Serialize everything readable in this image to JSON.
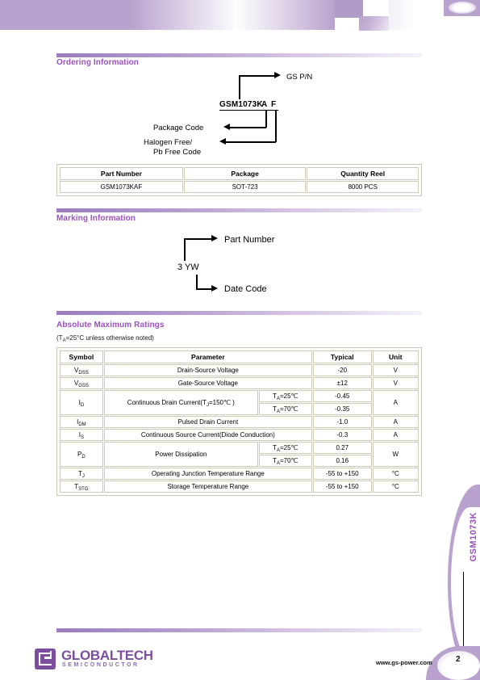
{
  "document": {
    "part": "GSM1073K",
    "page_number": "2",
    "website": "www.gs-power.com",
    "company": "GLOBALTECH",
    "company_sub": "SEMICONDUCTOR",
    "brand_color": "#9b51c0",
    "logo_color": "#7b4f9e",
    "banner_color": "#b9a2cd"
  },
  "ordering": {
    "title": "Ordering Information",
    "diagram": {
      "part_number_base": "GSM1073K",
      "code_a": "A",
      "code_f": "F",
      "label_gs_pn": "GS P/N",
      "label_package_code": "Package Code",
      "label_halogen_1": "Halogen Free/",
      "label_halogen_2": "Pb Free Code"
    },
    "table": {
      "headers": [
        "Part Number",
        "Package",
        "Quantity Reel"
      ],
      "rows": [
        [
          "GSM1073KAF",
          "SOT-723",
          "8000 PCS"
        ]
      ]
    }
  },
  "marking": {
    "title": "Marking Information",
    "code": "3 YW",
    "label_part_number": "Part Number",
    "label_date_code": "Date Code"
  },
  "ratings": {
    "title": "Absolute Maximum Ratings",
    "subtitle_pre": "(T",
    "subtitle_sub": "A",
    "subtitle_post": "=25°C unless otherwise noted)",
    "headers": [
      "Symbol",
      "Parameter",
      "Typical",
      "Unit"
    ],
    "rows": [
      {
        "symbol": "V",
        "symbol_sub": "DSS",
        "parameter": "Drain-Source Voltage",
        "condition": "",
        "typical": "-20",
        "unit": "V"
      },
      {
        "symbol": "V",
        "symbol_sub": "GSS",
        "parameter": "Gate-Source Voltage",
        "condition": "",
        "typical": "±12",
        "unit": "V"
      },
      {
        "symbol": "I",
        "symbol_sub": "D",
        "parameter": "Continuous Drain Current(T",
        "parameter_sub": "J",
        "parameter_post": "=150℃ )",
        "conditions": [
          "Tᴀ=25℃",
          "Tᴀ=70℃"
        ],
        "condition_1_pre": "T",
        "condition_1_sub": "A",
        "condition_1_post": "=25℃",
        "condition_2_pre": "T",
        "condition_2_sub": "A",
        "condition_2_post": "=70℃",
        "typicals": [
          "-0.45",
          "-0.35"
        ],
        "unit": "A"
      },
      {
        "symbol": "I",
        "symbol_sub": "DM",
        "parameter": "Pulsed Drain Current",
        "condition": "",
        "typical": "-1.0",
        "unit": "A"
      },
      {
        "symbol": "I",
        "symbol_sub": "S",
        "parameter": "Continuous Source Current(Diode Conduction)",
        "condition": "",
        "typical": "-0.3",
        "unit": "A"
      },
      {
        "symbol": "P",
        "symbol_sub": "D",
        "parameter": "Power Dissipation",
        "condition_1_pre": "T",
        "condition_1_sub": "A",
        "condition_1_post": "=25℃",
        "condition_2_pre": "T",
        "condition_2_sub": "A",
        "condition_2_post": "=70℃",
        "typicals": [
          "0.27",
          "0.16"
        ],
        "unit": "W"
      },
      {
        "symbol": "T",
        "symbol_sub": "J",
        "parameter": "Operating Junction Temperature Range",
        "condition": "",
        "typical": "-55 to +150",
        "unit": "°C"
      },
      {
        "symbol": "T",
        "symbol_sub": "STG",
        "parameter": "Storage Temperature Range",
        "condition": "",
        "typical": "-55 to +150",
        "unit": "°C"
      }
    ]
  }
}
